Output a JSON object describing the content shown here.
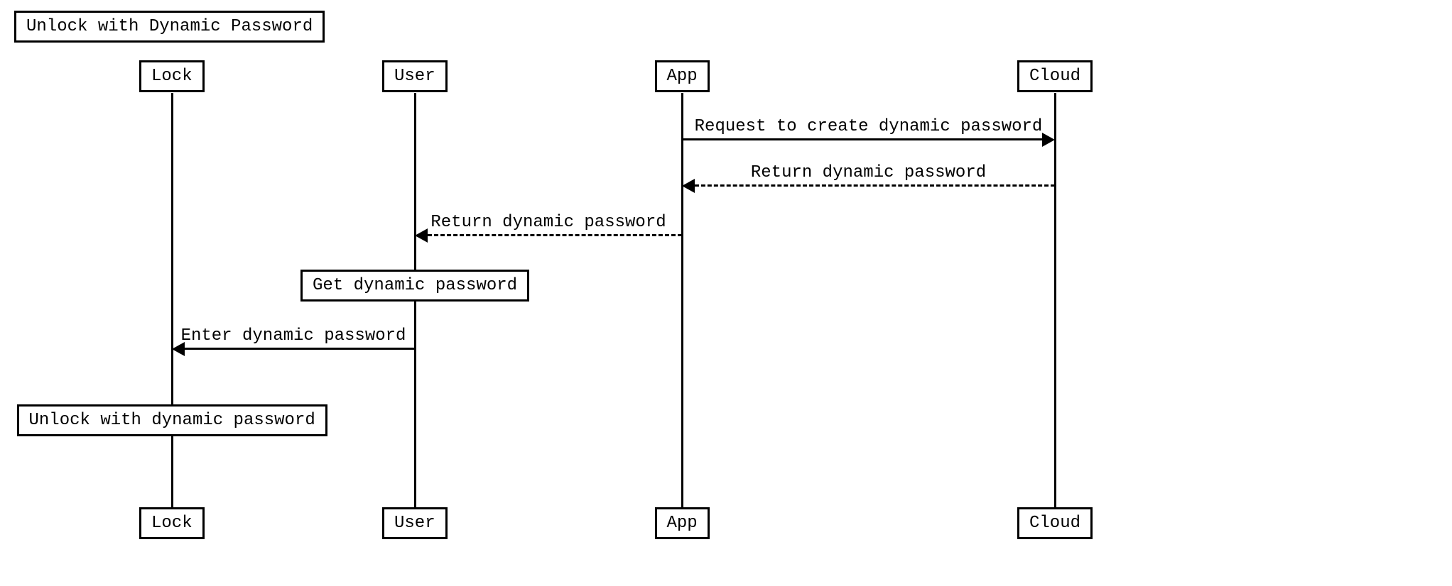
{
  "diagram": {
    "title": "Unlock with Dynamic Password",
    "participants": [
      "Lock",
      "User",
      "App",
      "Cloud"
    ],
    "messages": [
      {
        "from": "App",
        "to": "Cloud",
        "label": "Request to create dynamic password",
        "style": "solid"
      },
      {
        "from": "Cloud",
        "to": "App",
        "label": "Return dynamic password",
        "style": "dashed"
      },
      {
        "from": "App",
        "to": "User",
        "label": "Return dynamic password",
        "style": "dashed"
      },
      {
        "from": "User",
        "to": "User",
        "label": "Get dynamic password",
        "style": "self"
      },
      {
        "from": "User",
        "to": "Lock",
        "label": "Enter dynamic password",
        "style": "solid"
      },
      {
        "from": "Lock",
        "to": "Lock",
        "label": "Unlock with dynamic password",
        "style": "self"
      }
    ]
  },
  "layout": {
    "x": {
      "Lock": 242,
      "User": 584,
      "App": 960,
      "Cloud": 1485
    }
  }
}
